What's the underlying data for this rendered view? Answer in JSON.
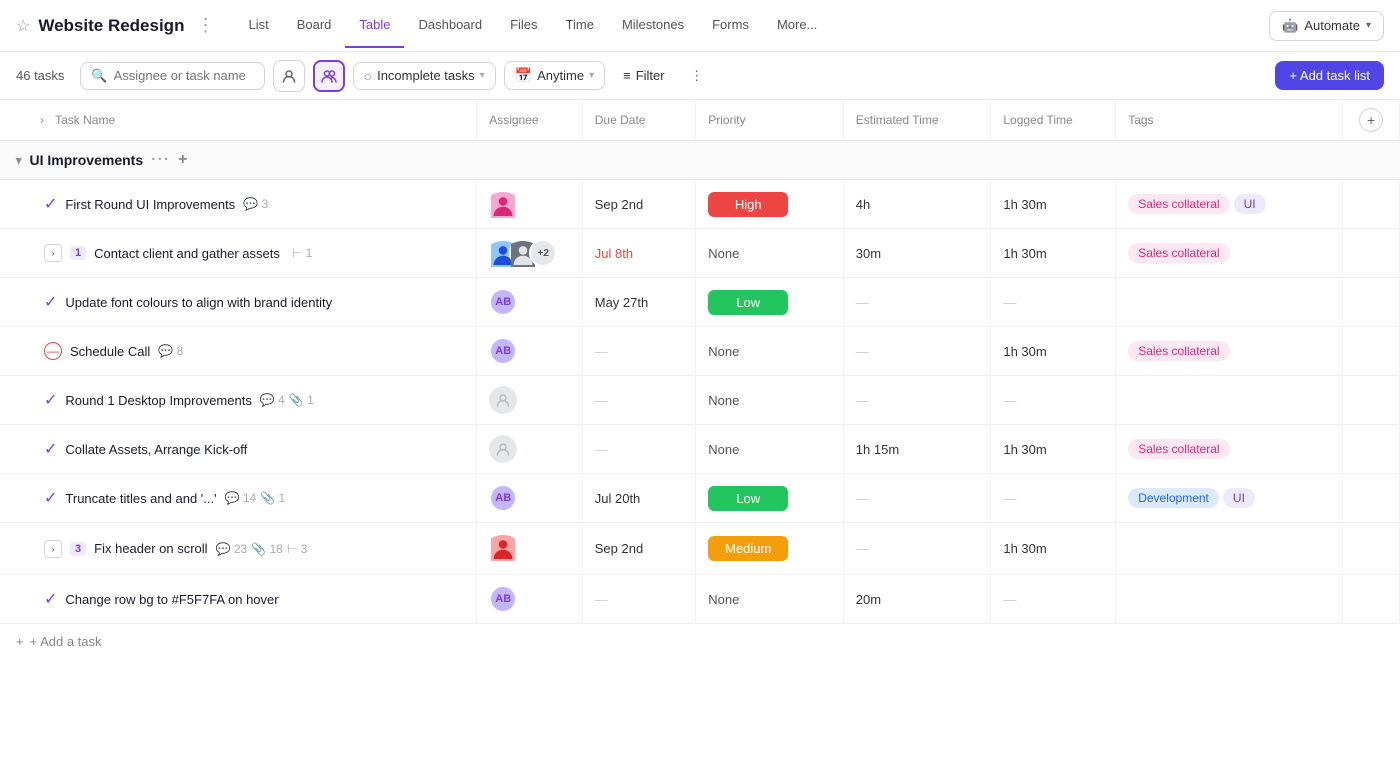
{
  "project": {
    "title": "Website Redesign",
    "task_count": "46 tasks"
  },
  "nav": {
    "tabs": [
      {
        "label": "List",
        "active": false
      },
      {
        "label": "Board",
        "active": false
      },
      {
        "label": "Table",
        "active": true
      },
      {
        "label": "Dashboard",
        "active": false
      },
      {
        "label": "Files",
        "active": false
      },
      {
        "label": "Time",
        "active": false
      },
      {
        "label": "Milestones",
        "active": false
      },
      {
        "label": "Forms",
        "active": false
      },
      {
        "label": "More...",
        "active": false
      }
    ],
    "automate_label": "Automate"
  },
  "toolbar": {
    "search_placeholder": "Assignee or task name",
    "incomplete_tasks_label": "Incomplete tasks",
    "anytime_label": "Anytime",
    "filter_label": "Filter",
    "add_task_list_label": "+ Add task list"
  },
  "table": {
    "columns": [
      {
        "label": "Task Name"
      },
      {
        "label": "Assignee"
      },
      {
        "label": "Due Date"
      },
      {
        "label": "Priority"
      },
      {
        "label": "Estimated Time"
      },
      {
        "label": "Logged Time"
      },
      {
        "label": "Tags"
      }
    ],
    "group": {
      "label": "UI Improvements"
    },
    "rows": [
      {
        "id": 1,
        "name": "First Round UI Improvements",
        "status": "completed",
        "comments": 3,
        "assignee_type": "avatar_img",
        "assignee_color": "#f9a8d4",
        "assignee_initials": "",
        "due_date": "Sep 2nd",
        "due_overdue": false,
        "priority": "High",
        "priority_type": "high",
        "est_time": "4h",
        "logged_time": "1h 30m",
        "tags": [
          {
            "label": "Sales collateral",
            "type": "pink"
          },
          {
            "label": "UI",
            "type": "purple"
          }
        ],
        "expandable": false,
        "indent": false
      },
      {
        "id": 2,
        "name": "Contact client and gather assets",
        "status": "expandable",
        "num_badge": "1",
        "subtask_count": 1,
        "assignee_type": "multi",
        "due_date": "Jul 8th",
        "due_overdue": true,
        "priority": "None",
        "priority_type": "none",
        "est_time": "30m",
        "logged_time": "1h 30m",
        "tags": [
          {
            "label": "Sales collateral",
            "type": "pink"
          }
        ],
        "expandable": true,
        "indent": false
      },
      {
        "id": 3,
        "name": "Update font colours to align with brand identity",
        "status": "completed",
        "assignee_type": "initials",
        "assignee_initials": "AB",
        "assignee_color": "#c4b5fd",
        "due_date": "May 27th",
        "due_overdue": false,
        "priority": "Low",
        "priority_type": "low",
        "est_time": "—",
        "logged_time": "—",
        "tags": [],
        "expandable": false,
        "indent": false
      },
      {
        "id": 4,
        "name": "Schedule Call",
        "status": "cancelled",
        "comments": 8,
        "assignee_type": "initials",
        "assignee_initials": "AB",
        "assignee_color": "#c4b5fd",
        "due_date": "—",
        "due_overdue": false,
        "priority": "None",
        "priority_type": "none",
        "est_time": "—",
        "logged_time": "1h 30m",
        "tags": [
          {
            "label": "Sales collateral",
            "type": "pink"
          }
        ],
        "expandable": false,
        "indent": false
      },
      {
        "id": 5,
        "name": "Round 1 Desktop Improvements",
        "status": "completed",
        "comments": 4,
        "attachments": 1,
        "assignee_type": "empty",
        "due_date": "—",
        "due_overdue": false,
        "priority": "None",
        "priority_type": "none",
        "est_time": "—",
        "logged_time": "—",
        "tags": [],
        "expandable": false,
        "indent": false
      },
      {
        "id": 6,
        "name": "Collate Assets, Arrange Kick-off",
        "status": "completed",
        "assignee_type": "empty",
        "due_date": "—",
        "due_overdue": false,
        "priority": "None",
        "priority_type": "none",
        "est_time": "1h 15m",
        "logged_time": "1h 30m",
        "tags": [
          {
            "label": "Sales collateral",
            "type": "pink"
          }
        ],
        "expandable": false,
        "indent": false
      },
      {
        "id": 7,
        "name": "Truncate titles and and '...'",
        "status": "completed",
        "comments": 14,
        "attachments": 1,
        "assignee_type": "initials",
        "assignee_initials": "AB",
        "assignee_color": "#c4b5fd",
        "due_date": "Jul 20th",
        "due_overdue": false,
        "priority": "Low",
        "priority_type": "low",
        "est_time": "—",
        "logged_time": "—",
        "tags": [
          {
            "label": "Development",
            "type": "blue"
          },
          {
            "label": "UI",
            "type": "purple"
          }
        ],
        "expandable": false,
        "indent": false
      },
      {
        "id": 8,
        "name": "Fix header on scroll",
        "status": "expandable",
        "num_badge": "3",
        "comments": 23,
        "attachments": 18,
        "subtask_count": 3,
        "assignee_type": "avatar_img2",
        "due_date": "Sep 2nd",
        "due_overdue": false,
        "priority": "Medium",
        "priority_type": "medium",
        "est_time": "—",
        "logged_time": "1h 30m",
        "tags": [],
        "expandable": true,
        "indent": false
      },
      {
        "id": 9,
        "name": "Change row bg to #F5F7FA on hover",
        "status": "completed",
        "assignee_type": "initials",
        "assignee_initials": "AB",
        "assignee_color": "#c4b5fd",
        "due_date": "—",
        "due_overdue": false,
        "priority": "None",
        "priority_type": "none",
        "est_time": "20m",
        "logged_time": "—",
        "tags": [],
        "expandable": false,
        "indent": false
      }
    ]
  },
  "add_task": "+ Add a task"
}
